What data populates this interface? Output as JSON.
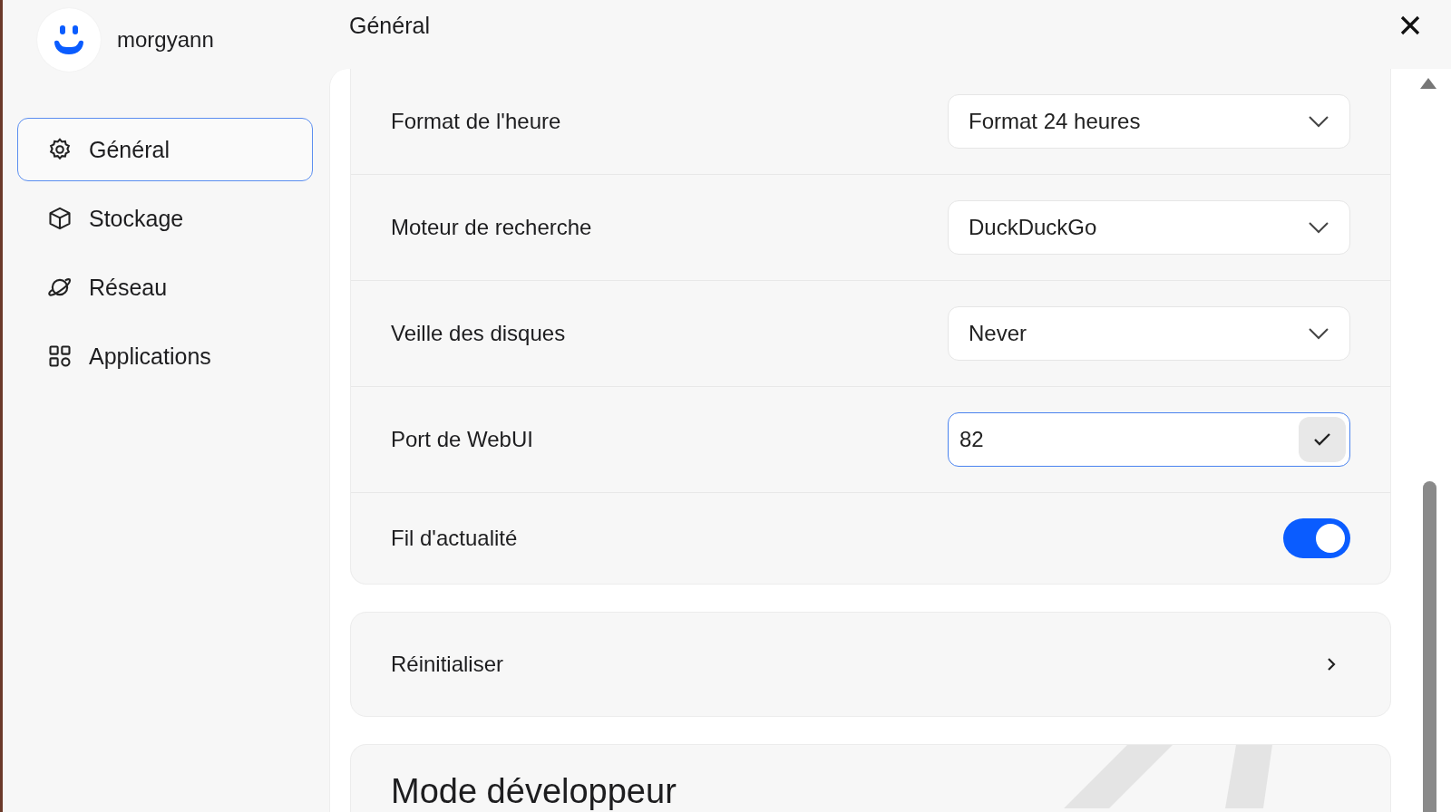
{
  "user": {
    "name": "morgyann"
  },
  "sidebar": {
    "items": [
      {
        "label": "Général",
        "kind": "gear",
        "selected": true
      },
      {
        "label": "Stockage",
        "kind": "cube",
        "selected": false
      },
      {
        "label": "Réseau",
        "kind": "planet",
        "selected": false
      },
      {
        "label": "Applications",
        "kind": "grid",
        "selected": false
      }
    ]
  },
  "header": {
    "title": "Général"
  },
  "settings": [
    {
      "kind": "select",
      "label": "Format de l'heure",
      "value": "Format 24 heures"
    },
    {
      "kind": "select",
      "label": "Moteur de recherche",
      "value": "DuckDuckGo"
    },
    {
      "kind": "select",
      "label": "Veille des disques",
      "value": "Never"
    },
    {
      "kind": "input",
      "label": "Port de WebUI",
      "value": "82"
    },
    {
      "kind": "toggle",
      "label": "Fil d'actualité",
      "on": true
    }
  ],
  "reset": {
    "label": "Réinitialiser"
  },
  "developer": {
    "title": "Mode développeur"
  }
}
